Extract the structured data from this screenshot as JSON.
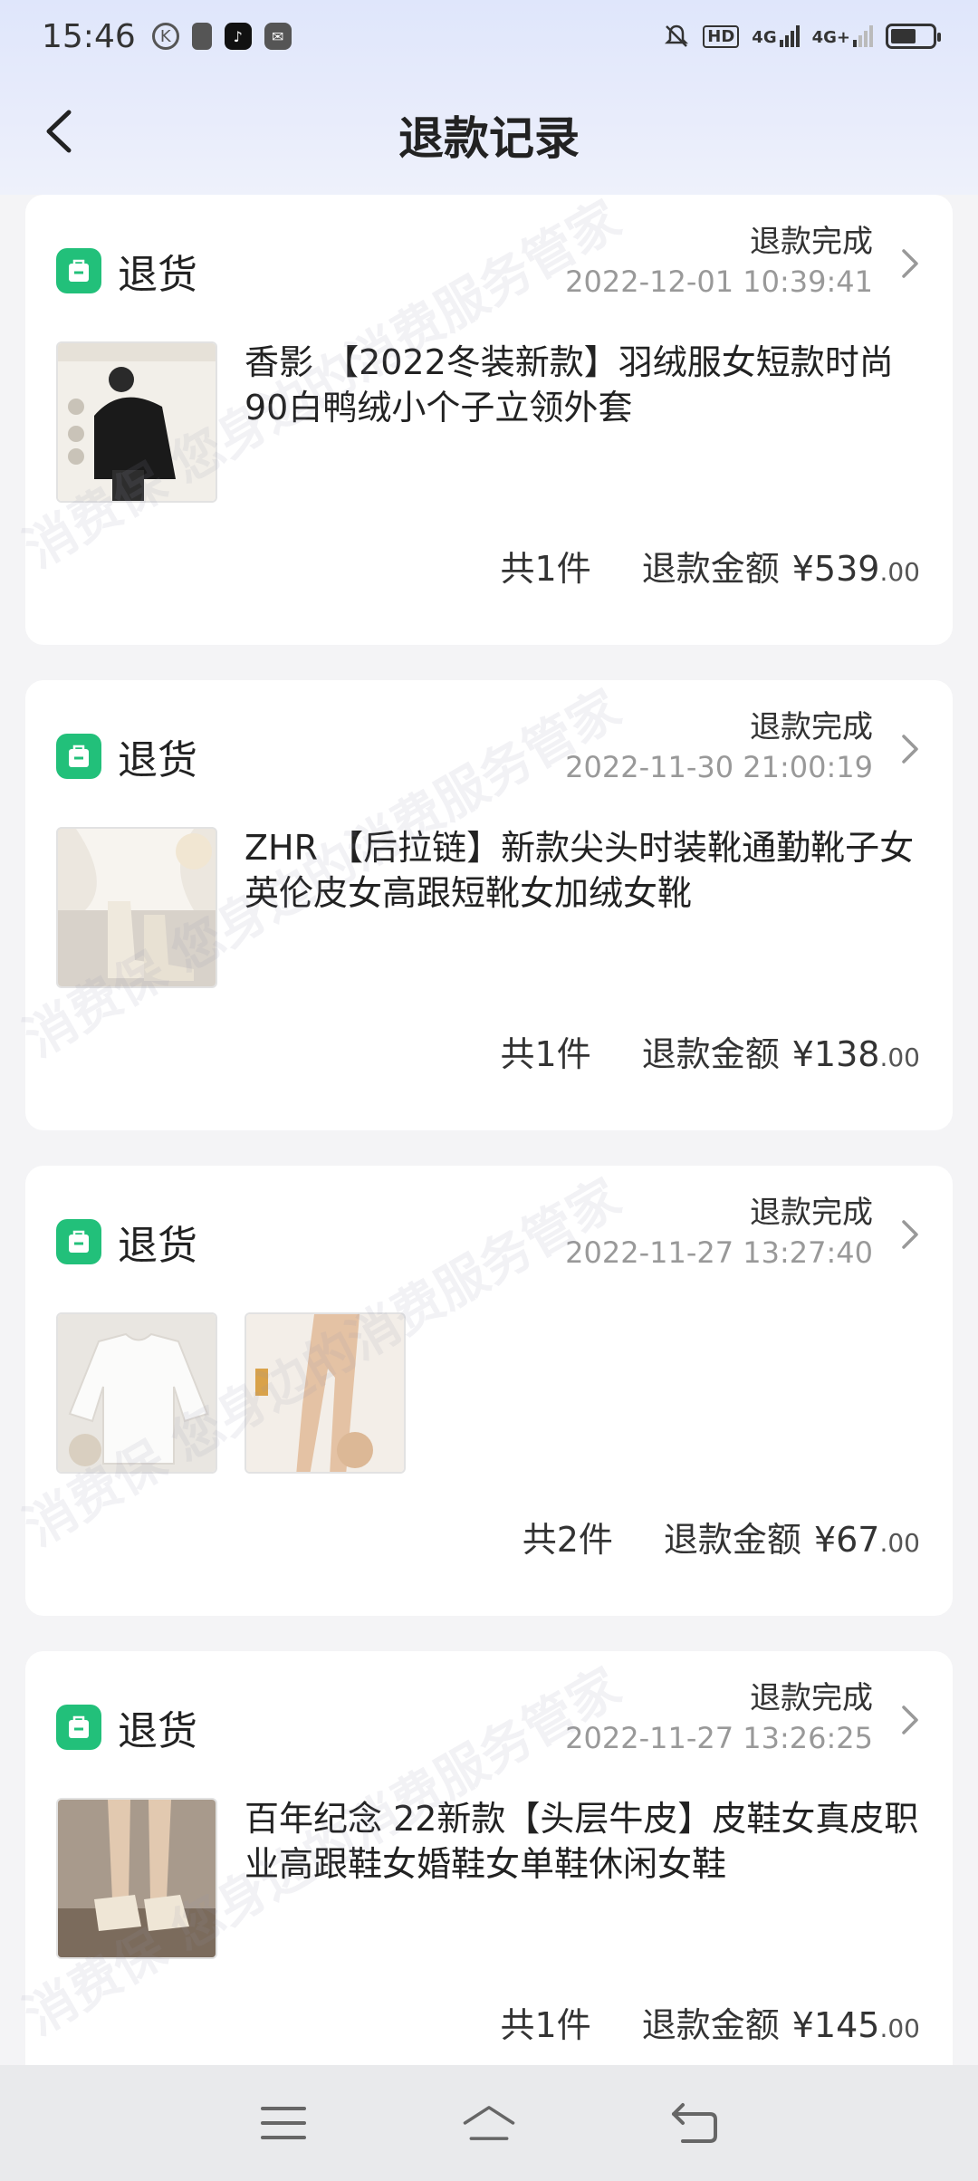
{
  "status_bar": {
    "time": "15:46",
    "left_icons": [
      "k-circle-icon",
      "cup-icon",
      "tiktok-icon",
      "mail-icon"
    ],
    "right_icons": [
      "mute-bell-icon",
      "hd-icon",
      "4g-signal-icon",
      "4g-plus-signal-icon",
      "battery-icon"
    ],
    "hd_label": "HD",
    "net1": "4G",
    "net2": "4G+"
  },
  "header": {
    "title": "退款记录",
    "back_icon": "chevron-left-icon"
  },
  "watermark_text": "消费保 您身边的消费服务管家",
  "colors": {
    "accent_green": "#22c07a",
    "header_bg": "#dfe6fb",
    "text_primary": "#222222",
    "text_secondary": "#999999"
  },
  "refunds": [
    {
      "type": "退货",
      "status": "退款完成",
      "date": "2022-12-01  10:39:41",
      "title": "香影 【2022冬装新款】羽绒服女短款时尚90白鸭绒小个子立领外套",
      "count": "共1件",
      "amount_label": "退款金额",
      "price_int": "¥539",
      "price_dec": ".00"
    },
    {
      "type": "退货",
      "status": "退款完成",
      "date": "2022-11-30  21:00:19",
      "title": "ZHR 【后拉链】新款尖头时装靴通勤靴子女英伦皮女高跟短靴女加绒女靴",
      "count": "共1件",
      "amount_label": "退款金额",
      "price_int": "¥138",
      "price_dec": ".00"
    },
    {
      "type": "退货",
      "status": "退款完成",
      "date": "2022-11-27  13:27:40",
      "title": "",
      "count": "共2件",
      "amount_label": "退款金额",
      "price_int": "¥67",
      "price_dec": ".00"
    },
    {
      "type": "退货",
      "status": "退款完成",
      "date": "2022-11-27  13:26:25",
      "title": "百年纪念 22新款【头层牛皮】皮鞋女真皮职业高跟鞋女婚鞋女单鞋休闲女鞋",
      "count": "共1件",
      "amount_label": "退款金额",
      "price_int": "¥145",
      "price_dec": ".00"
    }
  ],
  "navbar": {
    "icons": [
      "menu-icon",
      "home-icon",
      "back-icon"
    ]
  }
}
